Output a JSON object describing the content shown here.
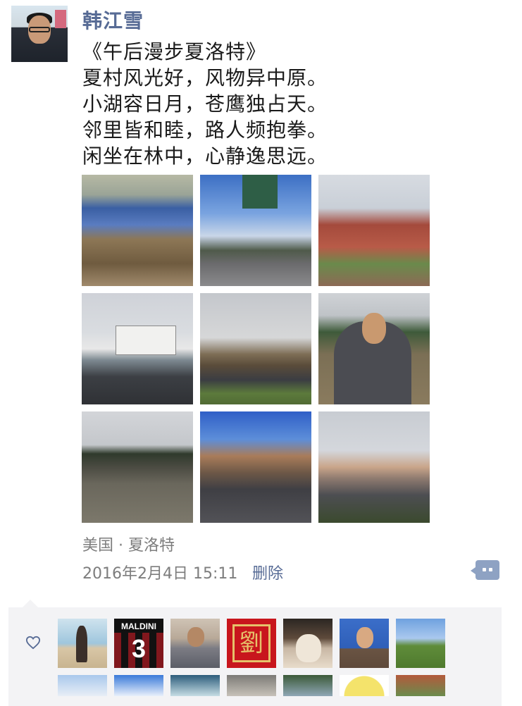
{
  "post": {
    "username": "韩江雪",
    "poem_lines": [
      "《午后漫步夏洛特》",
      "夏村风光好，风物异中原。",
      "小湖容日月，苍鹰独占天。",
      "邻里皆和睦，路人频抱拳。",
      "闲坐在林中，心静逸思远。"
    ],
    "photo_count": 9,
    "location": "美国 · 夏洛特",
    "timestamp": "2016年2月4日 15:11",
    "delete_label": "删除"
  },
  "icons": {
    "comment": "comment-more-icon",
    "like": "heart-outline-icon"
  },
  "likers": {
    "tile_text": {
      "maldini_name": "MALDINI",
      "maldini_number": "3",
      "seal_char": "劉"
    },
    "visible_count": 14
  },
  "colors": {
    "link_blue": "#576b95",
    "meta_gray": "#7d7d7d",
    "panel_bg": "#f3f3f5",
    "comment_btn": "#8ea2c3"
  }
}
